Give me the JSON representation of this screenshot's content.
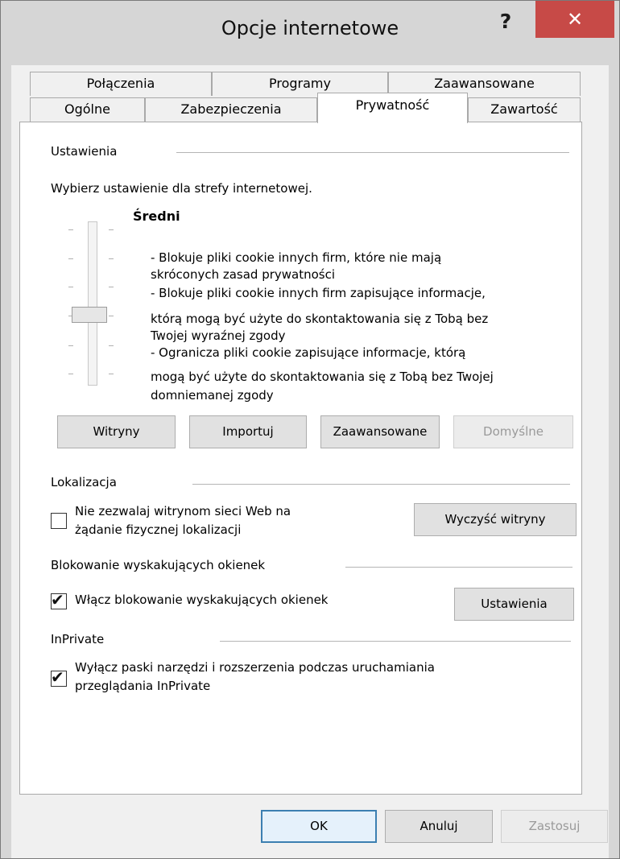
{
  "window": {
    "title": "Opcje internetowe",
    "help_label": "?",
    "close_label": "✕"
  },
  "tabs_top": [
    "Połączenia",
    "Programy",
    "Zaawansowane"
  ],
  "tabs_bottom": [
    "Ogólne",
    "Zabezpieczenia",
    "Prywatność",
    "Zawartość"
  ],
  "active_tab": "Prywatność",
  "settings": {
    "label": "Ustawienia",
    "instruction": "Wybierz ustawienie dla strefy internetowej.",
    "level": "Średni",
    "description_lines": [
      "- Blokuje pliki cookie innych firm, które nie mają",
      "skróconych zasad prywatności",
      "- Blokuje pliki cookie innych firm zapisujące informacje,",
      "którą mogą być użyte do skontaktowania się z Tobą bez",
      "Twojej wyraźnej zgody",
      "- Ogranicza pliki cookie zapisujące informacje, którą",
      "mogą być użyte do skontaktowania się z Tobą bez Twojej",
      "domniemanej zgody"
    ],
    "buttons": {
      "sites": "Witryny",
      "import": "Importuj",
      "advanced": "Zaawansowane",
      "default": "Domyślne"
    }
  },
  "location": {
    "label": "Lokalizacja",
    "checkbox_line1": "Nie zezwalaj witrynom sieci Web na",
    "checkbox_line2": "żądanie fizycznej lokalizacji",
    "checked": false,
    "clear_button": "Wyczyść witryny"
  },
  "popup": {
    "label": "Blokowanie wyskakujących okienek",
    "checkbox_label": "Włącz blokowanie wyskakujących okienek",
    "checked": true,
    "settings_button": "Ustawienia"
  },
  "inprivate": {
    "label": "InPrivate",
    "checkbox_line1": "Wyłącz paski narzędzi i rozszerzenia podczas uruchamiania",
    "checkbox_line2": "przeglądania InPrivate",
    "checked": true
  },
  "footer": {
    "ok": "OK",
    "cancel": "Anuluj",
    "apply": "Zastosuj"
  },
  "colors": {
    "close_button": "#c74a47",
    "focus_border": "#3c7fb1",
    "window_background": "#d6d6d6"
  }
}
